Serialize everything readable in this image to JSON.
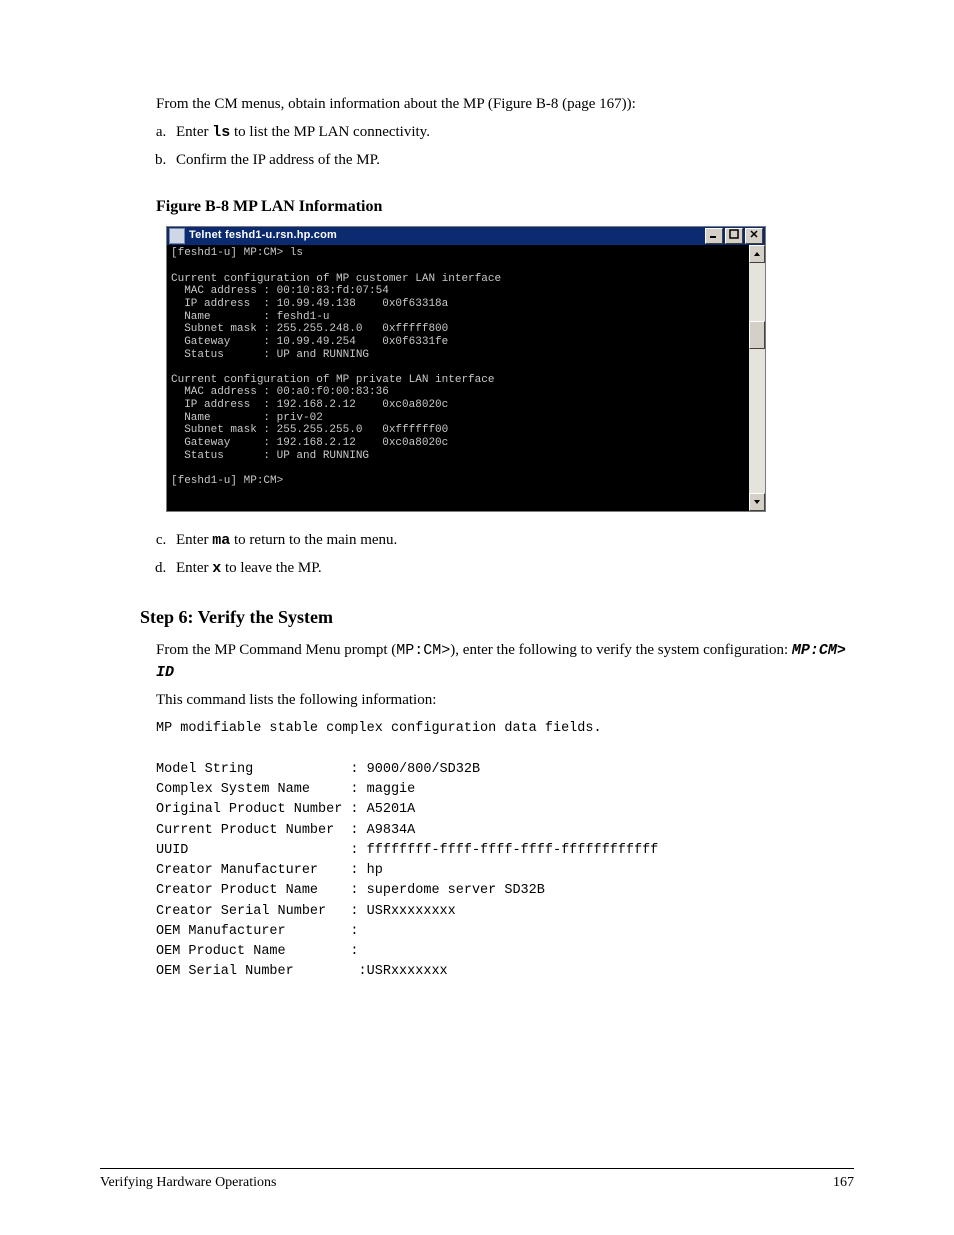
{
  "page_head": "From the CM menus, obtain information about the MP (Figure B-8 (page 167)):",
  "steps_a": [
    {
      "pre": "Enter ",
      "code": "ls",
      "post": " to list the MP LAN connectivity."
    },
    {
      "pre": "Confirm the IP address of the MP.",
      "code": "",
      "post": ""
    }
  ],
  "fig_title": "Figure B-8 MP LAN Information",
  "window_title": "Telnet feshd1-u.rsn.hp.com",
  "terminal_text": "[feshd1-u] MP:CM> ls\n\nCurrent configuration of MP customer LAN interface\n  MAC address : 00:10:83:fd:07:54\n  IP address  : 10.99.49.138    0x0f63318a\n  Name        : feshd1-u\n  Subnet mask : 255.255.248.0   0xfffff800\n  Gateway     : 10.99.49.254    0x0f6331fe\n  Status      : UP and RUNNING\n\nCurrent configuration of MP private LAN interface\n  MAC address : 00:a0:f0:00:83:36\n  IP address  : 192.168.2.12    0xc0a8020c\n  Name        : priv-02\n  Subnet mask : 255.255.255.0   0xffffff00\n  Gateway     : 192.168.2.12    0xc0a8020c\n  Status      : UP and RUNNING\n\n[feshd1-u] MP:CM>",
  "ma_line": {
    "pre": "Enter ",
    "code": "ma",
    "post": " to return to the main menu."
  },
  "x_line": {
    "pre": "Enter ",
    "code": "x",
    "post": " to leave the MP."
  },
  "step6_title": "Step 6: Verify the System",
  "step6_p1_pre": "From the MP Command Menu prompt (",
  "step6_p1_code": "MP:CM>",
  "step6_p1_post": "), enter the following to verify the system configuration: ",
  "step6_p1_cmd": "MP:CM> ID",
  "step6_p2": "This command lists the following information:",
  "output_text": "MP modifiable stable complex configuration data fields.\n\nModel String            : 9000/800/SD32B\nComplex System Name     : maggie\nOriginal Product Number : A5201A\nCurrent Product Number  : A9834A\nUUID                    : ffffffff-ffff-ffff-ffff-ffffffffffff\nCreator Manufacturer    : hp\nCreator Product Name    : superdome server SD32B\nCreator Serial Number   : USRxxxxxxxx\nOEM Manufacturer        :\nOEM Product Name        :\nOEM Serial Number        :USRxxxxxxx",
  "footer_left": "Verifying Hardware Operations",
  "footer_right": "167"
}
